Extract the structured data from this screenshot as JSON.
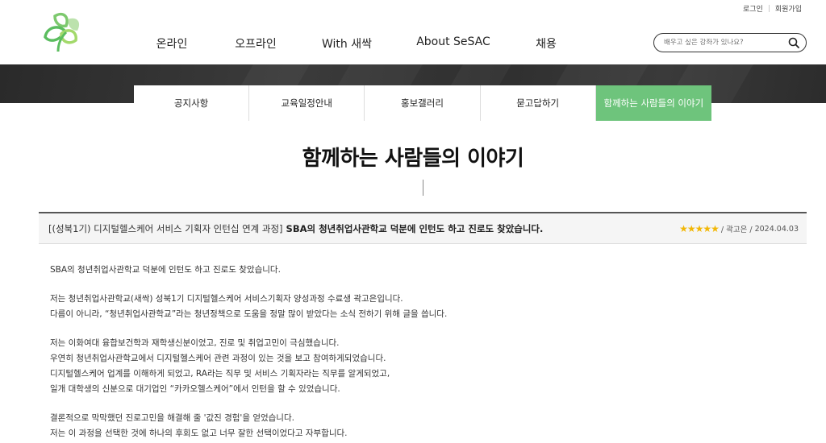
{
  "header": {
    "util": {
      "login": "로그인",
      "separator": "|",
      "signup": "회원가입"
    },
    "nav": [
      "온라인",
      "오프라인",
      "With 새싹",
      "About SeSAC",
      "채용"
    ],
    "search": {
      "placeholder": "배우고 싶은 강좌가 있나요?"
    }
  },
  "subnav": {
    "items": [
      "공지사항",
      "교육일정안내",
      "홍보갤러리",
      "묻고답하기",
      "함께하는 사람들의 이야기"
    ],
    "active_index": 4
  },
  "page_title": "함께하는 사람들의 이야기",
  "post": {
    "category": "[(성북1기) 디지털헬스케어 서비스 기획자 인턴십 연계 과정]",
    "subject": "SBA의 청년취업사관학교 덕분에 인턴도 하고 진로도 찾았습니다.",
    "rating": 5,
    "stars": "★★★★★",
    "author": "/ 곽고은 /",
    "date": "2024.04.03",
    "paragraphs": [
      [
        "SBA의 청년취업사관학교 덕분에 인턴도 하고 진로도 찾았습니다."
      ],
      [
        "저는 청년취업사관학교(새싹) 성북1기 디지털헬스케어 서비스기획자 양성과정 수료생 곽고은입니다.",
        "다름이 아니라, “청년취업사관학교”라는 청년정책으로 도움을 정말 많이 받았다는 소식 전하기 위해 글을 씁니다."
      ],
      [
        "저는 이화여대 융합보건학과 재학생신분이었고, 진로 및 취업고민이 극심했습니다.",
        "우연히 청년취업사관학교에서 디지털헬스케어 관련 과정이 있는 것을 보고 참여하게되었습니다.",
        "디지털헬스케어 업계를 이해하게 되었고, RA라는 직무 및 서비스 기획자라는 직무를 알게되었고,",
        "일개 대학생의 신분으로 대기업인 “카카오헬스케어”에서 인턴을 할 수 있었습니다."
      ],
      [
        "결론적으로 막막했던 진로고민을 해결해 줄 '값진 경험'을 얻었습니다.",
        "저는 이 과정을 선택한 것에 하나의 후회도 없고 너무 잘한 선택이었다고 자부합니다."
      ]
    ]
  },
  "colors": {
    "accent_green": "#6ec47c",
    "banner_dark": "#333333",
    "star": "#f2b705"
  }
}
